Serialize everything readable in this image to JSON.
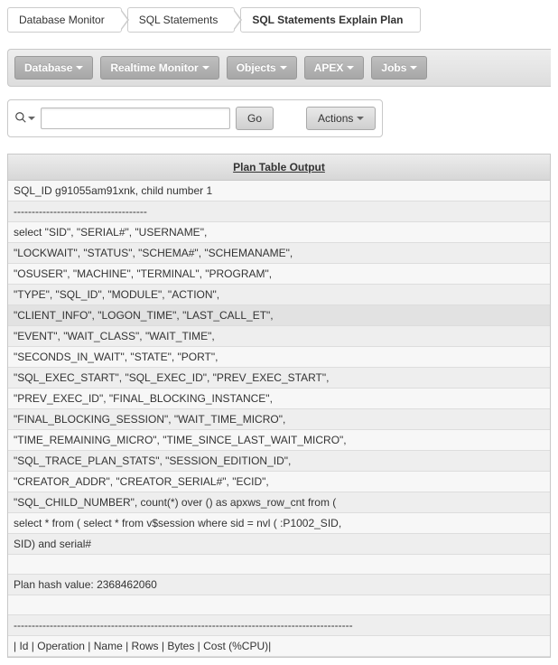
{
  "breadcrumb": {
    "items": [
      {
        "label": "Database Monitor"
      },
      {
        "label": "SQL Statements"
      },
      {
        "label": "SQL Statements Explain Plan"
      }
    ]
  },
  "toolbar": {
    "items": [
      {
        "label": "Database"
      },
      {
        "label": "Realtime Monitor"
      },
      {
        "label": "Objects"
      },
      {
        "label": "APEX"
      },
      {
        "label": "Jobs"
      }
    ]
  },
  "search": {
    "value": "",
    "go_label": "Go",
    "actions_label": "Actions"
  },
  "plan": {
    "header": "Plan Table Output",
    "rows": [
      "SQL_ID g91055am91xnk, child number 1",
      "-------------------------------------",
      "select \"SID\", \"SERIAL#\", \"USERNAME\",",
      "\"LOCKWAIT\", \"STATUS\", \"SCHEMA#\", \"SCHEMANAME\",",
      "\"OSUSER\", \"MACHINE\", \"TERMINAL\", \"PROGRAM\",",
      "\"TYPE\", \"SQL_ID\", \"MODULE\", \"ACTION\",",
      "\"CLIENT_INFO\", \"LOGON_TIME\", \"LAST_CALL_ET\",",
      "\"EVENT\", \"WAIT_CLASS\", \"WAIT_TIME\",",
      "\"SECONDS_IN_WAIT\", \"STATE\", \"PORT\",",
      "\"SQL_EXEC_START\", \"SQL_EXEC_ID\", \"PREV_EXEC_START\",",
      "\"PREV_EXEC_ID\", \"FINAL_BLOCKING_INSTANCE\",",
      "\"FINAL_BLOCKING_SESSION\", \"WAIT_TIME_MICRO\",",
      "\"TIME_REMAINING_MICRO\", \"TIME_SINCE_LAST_WAIT_MICRO\",",
      "\"SQL_TRACE_PLAN_STATS\", \"SESSION_EDITION_ID\",",
      "\"CREATOR_ADDR\", \"CREATOR_SERIAL#\", \"ECID\",",
      "\"SQL_CHILD_NUMBER\", count(*) over () as apxws_row_cnt from (",
      "select * from ( select * from v$session where sid = nvl ( :P1002_SID,",
      "SID) and serial#",
      "",
      "Plan hash value: 2368462060",
      "",
      "----------------------------------------------------------------------------------------------",
      "| Id | Operation | Name | Rows | Bytes | Cost (%CPU)|"
    ]
  }
}
